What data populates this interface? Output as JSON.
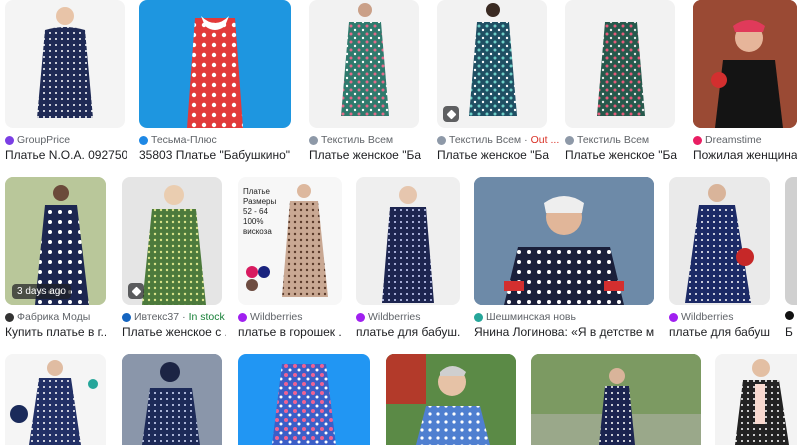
{
  "row1": [
    {
      "source": "GroupPrice",
      "title": "Платье N.O.A. 092750...",
      "fav": "#7b3fe4"
    },
    {
      "source": "Тесьма-Плюс",
      "title": "35803 Платье \"Бабушкино\" ...",
      "fav": "#1e88e5"
    },
    {
      "source": "Текстиль Всем",
      "title": "Платье женское \"Ба...",
      "fav": "#8e99a8"
    },
    {
      "source": "Текстиль Всем",
      "status": "Out ...",
      "title": "Платье женское \"Ба...",
      "fav": "#8e99a8"
    },
    {
      "source": "Текстиль Всем",
      "title": "Платье женское \"Ба...",
      "fav": "#8e99a8"
    },
    {
      "source": "Dreamstime",
      "title": "Пожилая женщина ...",
      "fav": "#e91e63"
    }
  ],
  "row2": [
    {
      "source": "Фабрика Моды",
      "title": "Купить платье в г...",
      "chip": "3 days ago",
      "fav": "#333333"
    },
    {
      "source": "Ивтекс37",
      "status": "In stock",
      "title": "Платье женское с ...",
      "fav": "#1565c0"
    },
    {
      "source": "Wildberries",
      "title": "платье в горошек ...",
      "fav": "#a020f0"
    },
    {
      "source": "Wildberries",
      "title": "платье для бабуш...",
      "fav": "#a020f0"
    },
    {
      "source": "Шешминская новь",
      "title": "Янина Логинова: «Я в детстве ме...",
      "fav": "#26a69a"
    },
    {
      "source": "Wildberries",
      "title": "платье для бабуш...",
      "fav": "#a020f0"
    },
    {
      "source": "",
      "title": "Б",
      "fav": "#111111"
    }
  ],
  "product_text": {
    "lines": [
      "Платье",
      "Размеры",
      "52 - 64",
      "100%",
      "вискоза"
    ]
  },
  "icons": [
    "image-badge-icon"
  ]
}
